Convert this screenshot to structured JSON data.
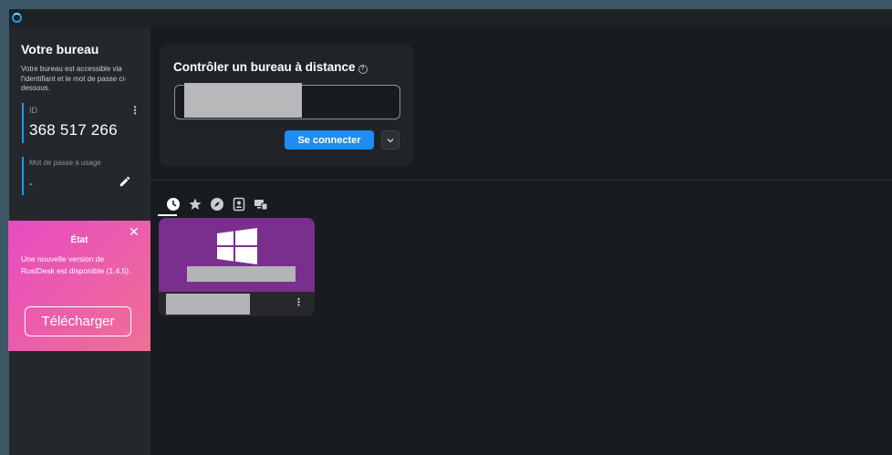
{
  "sidebar": {
    "title": "Votre bureau",
    "description": "Votre bureau est accessible via l'identifiant et le mot de passe ci-dessous.",
    "id_label": "ID",
    "id_value": "368 517 266",
    "id_menu_glyph": "⋮",
    "password_label": "Mot de passe à usage",
    "password_value": "-"
  },
  "status_card": {
    "title": "État",
    "close_glyph": "✕",
    "message": "Une nouvelle version de RustDesk est disponible (1.4.5).",
    "download_label": "Télécharger"
  },
  "connect": {
    "title": "Contrôler un bureau à distance",
    "help_glyph": "?",
    "input_value": "",
    "button_label": "Se connecter"
  },
  "peer_tabs": [
    {
      "icon": "recent-clock-icon",
      "active": true
    },
    {
      "icon": "favorites-star-icon",
      "active": false
    },
    {
      "icon": "discovered-compass-icon",
      "active": false
    },
    {
      "icon": "address-book-icon",
      "active": false
    },
    {
      "icon": "group-devices-icon",
      "active": false
    }
  ],
  "peer": {
    "os_icon": "windows-icon",
    "menu_glyph": "⋮"
  },
  "colors": {
    "accent": "#1e8cf2",
    "status_gradient_start": "#e84ac3",
    "status_gradient_end": "#f07094",
    "peer_card_purple": "#7a2e8e"
  }
}
